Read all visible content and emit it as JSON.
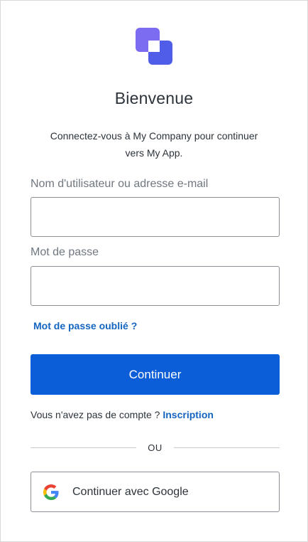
{
  "header": {
    "title": "Bienvenue",
    "subtitle_line1": "Connectez-vous à My Company pour continuer",
    "subtitle_line2": "vers My App."
  },
  "form": {
    "username_label": "Nom d'utilisateur ou adresse e-mail",
    "username_value": "",
    "password_label": "Mot de passe",
    "password_value": "",
    "forgot_link": "Mot de passe oublié ?",
    "submit_label": "Continuer"
  },
  "signup": {
    "prompt": "Vous n'avez pas de compte ?",
    "link": "Inscription"
  },
  "divider_text": "OU",
  "social": {
    "google_label": "Continuer avec Google",
    "icon": "google-icon"
  },
  "colors": {
    "primary": "#0b5ed7",
    "link": "#1565c0",
    "logo_light": "#7c6cf2",
    "logo_dark": "#4f5de8"
  }
}
